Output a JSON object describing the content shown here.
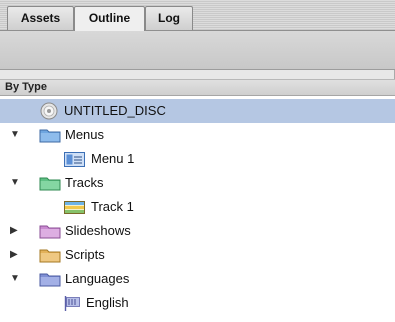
{
  "tabs": [
    {
      "label": "Assets"
    },
    {
      "label": "Outline"
    },
    {
      "label": "Log"
    }
  ],
  "group_header": "By Type",
  "tree": {
    "disc": {
      "label": "UNTITLED_DISC",
      "icon": "disc-icon"
    },
    "menus": {
      "label": "Menus",
      "icon": "folder-icon",
      "color": "#6fa6e0"
    },
    "menu1": {
      "label": "Menu 1",
      "icon": "menu-icon"
    },
    "tracks": {
      "label": "Tracks",
      "icon": "folder-icon",
      "color": "#5fc084"
    },
    "track1": {
      "label": "Track 1",
      "icon": "track-icon"
    },
    "slideshows": {
      "label": "Slideshows",
      "icon": "folder-icon",
      "color": "#c98ad0"
    },
    "scripts": {
      "label": "Scripts",
      "icon": "folder-icon",
      "color": "#e3b15a"
    },
    "languages": {
      "label": "Languages",
      "icon": "folder-icon",
      "color": "#7f8fd4"
    },
    "english": {
      "label": "English",
      "icon": "flag-icon"
    }
  },
  "colors": {
    "selection": "#b5c7e3"
  }
}
